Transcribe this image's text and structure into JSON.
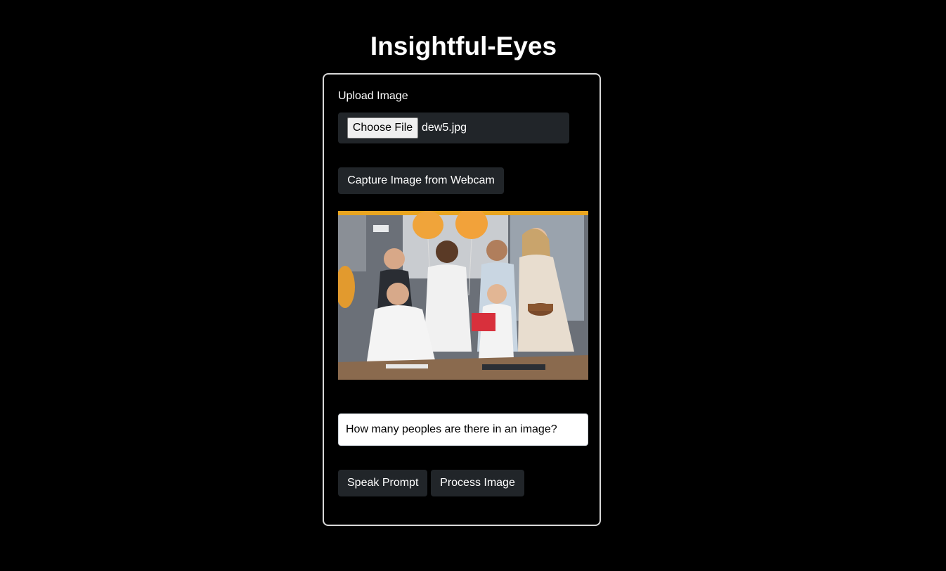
{
  "app": {
    "title": "Insightful-Eyes"
  },
  "upload": {
    "label": "Upload Image",
    "choose_file_label": "Choose File",
    "file_name": "dew5.jpg"
  },
  "webcam": {
    "button_label": "Capture Image from Webcam"
  },
  "preview": {
    "alt": "Uploaded image preview"
  },
  "prompt": {
    "value": "How many peoples are there in an image?"
  },
  "actions": {
    "speak_label": "Speak Prompt",
    "process_label": "Process Image"
  },
  "colors": {
    "background": "#000000",
    "button_bg": "#212529",
    "card_border": "#d8d8d8",
    "text": "#ffffff"
  }
}
